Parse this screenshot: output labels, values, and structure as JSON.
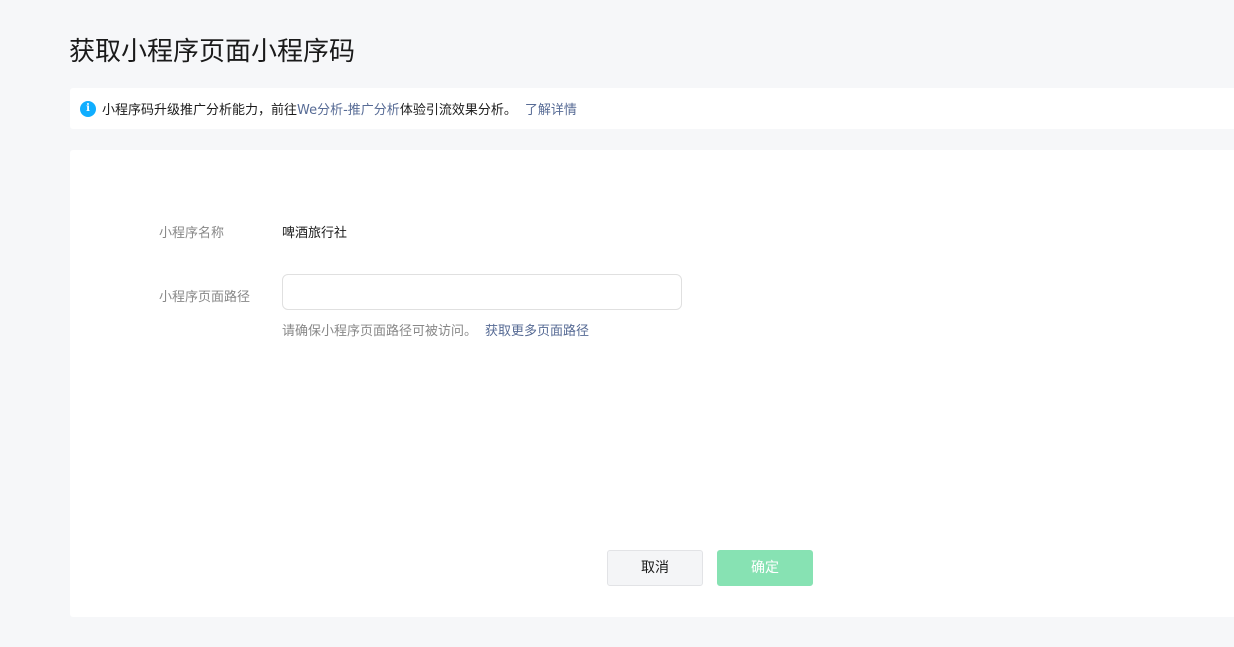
{
  "page": {
    "title": "获取小程序页面小程序码"
  },
  "notice": {
    "icon": "info-icon",
    "icon_glyph": "i",
    "text_before": "小程序码升级推广分析能力，前往",
    "link_text": "We分析-推广分析",
    "text_after": "体验引流效果分析。",
    "learn_more": "了解详情"
  },
  "form": {
    "name_label": "小程序名称",
    "name_value": "啤酒旅行社",
    "path_label": "小程序页面路径",
    "path_value": "",
    "path_placeholder": "",
    "hint_text": "请确保小程序页面路径可被访问。",
    "hint_link": "获取更多页面路径"
  },
  "actions": {
    "cancel_label": "取消",
    "confirm_label": "确定",
    "confirm_disabled": true
  },
  "colors": {
    "link": "#576b95",
    "info_icon": "#10aeff",
    "confirm_disabled_bg": "#87e2b3",
    "page_bg": "#f6f7f9"
  }
}
